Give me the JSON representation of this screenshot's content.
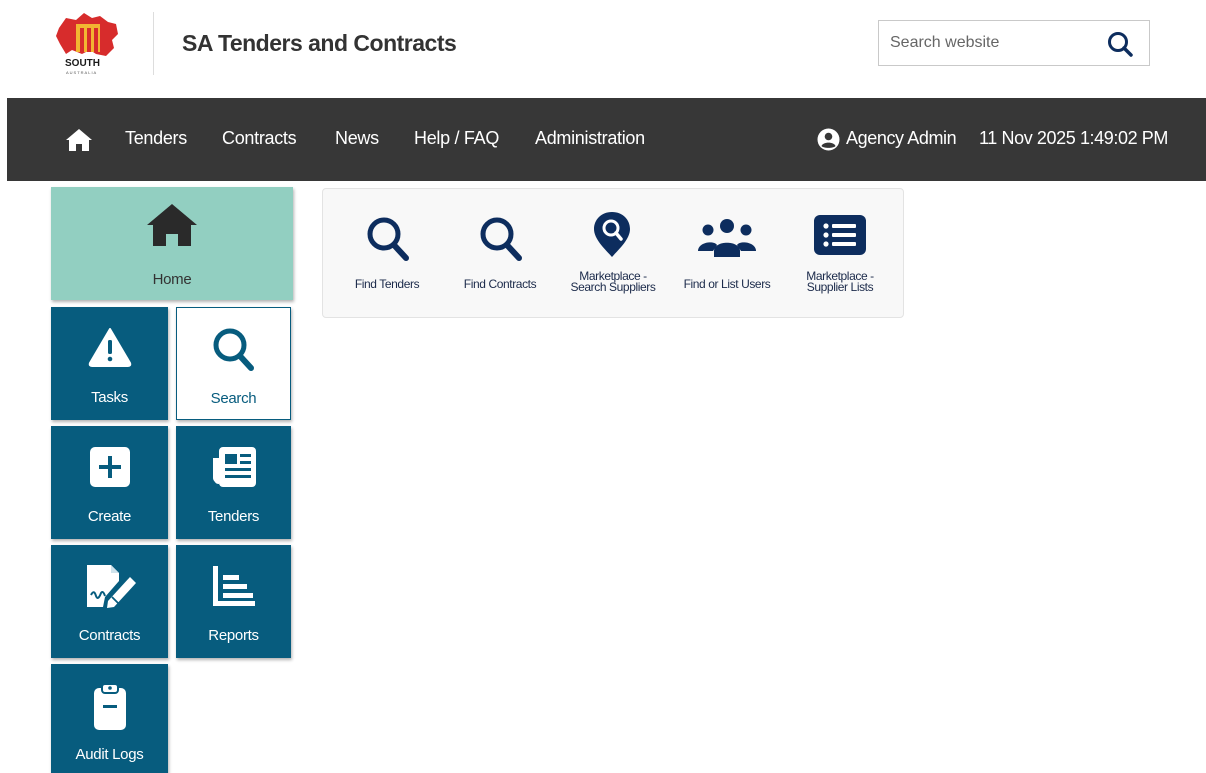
{
  "header": {
    "logo_word": "SOUTH",
    "logo_sub": "AUSTRALIA",
    "title": "SA Tenders and Contracts",
    "search_placeholder": "Search website"
  },
  "nav": {
    "links": [
      "Tenders",
      "Contracts",
      "News",
      "Help / FAQ",
      "Administration"
    ],
    "user": "Agency Admin",
    "datetime": "11 Nov 2025 1:49:02 PM"
  },
  "tiles": {
    "home": "Home",
    "tasks": "Tasks",
    "search": "Search",
    "create": "Create",
    "tenders": "Tenders",
    "contracts": "Contracts",
    "reports": "Reports",
    "audit_logs": "Audit Logs"
  },
  "search_panel": {
    "items": [
      {
        "line1": "Find Tenders",
        "line2": ""
      },
      {
        "line1": "Find Contracts",
        "line2": ""
      },
      {
        "line1": "Marketplace -",
        "line2": "Search Suppliers"
      },
      {
        "line1": "Find or List Users",
        "line2": ""
      },
      {
        "line1": "Marketplace -",
        "line2": "Supplier Lists"
      }
    ]
  },
  "colors": {
    "navbar": "#373737",
    "tile": "#075c7e",
    "home_tile": "#92cfc1",
    "panel_icon": "#0d2d5e",
    "logo_red": "#d72c2c"
  },
  "icons": {
    "nav": [
      "home-icon",
      "user-circle-icon"
    ],
    "tiles": [
      "home-icon",
      "warning-icon",
      "search-icon",
      "plus-square-icon",
      "newspaper-icon",
      "contract-signature-icon",
      "chart-bars-icon",
      "clipboard-icon"
    ],
    "panel": [
      "search-icon",
      "search-icon",
      "map-pin-search-icon",
      "users-icon",
      "list-icon"
    ]
  }
}
